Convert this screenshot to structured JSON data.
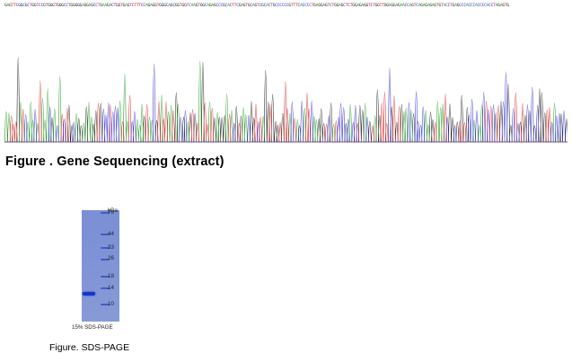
{
  "sequence": {
    "text": "GAGTTCGGCGCTGGTCCGTGGGTGGGCCTGGGGGAGGAGCCTGAAGACTGGTGAGTCTTTCCAGAGGTGGGCAGCGGTGGTCAAGTGGCAGAGCCCGCACTTCGAGTGCAGTCGCACTGCCCCCCGTTTCACCCCTGAGGAGTCTGGAGCTCTGGAGAGGTCTGGTTGGAGGAGAACCAGTCAGAGAGAGTGTACCTGAGCCCACCCACCCCACCTAGAGTG"
  },
  "chromatogram": {
    "colors": {
      "A": "#1f9b1f",
      "C": "#2b2bd6",
      "G": "#1a1a1a",
      "T": "#d62020"
    }
  },
  "gene_figure": {
    "caption": "Figure . Gene Sequencing (extract)"
  },
  "gel": {
    "unit_label": "kDa",
    "markers": [
      {
        "label": "70",
        "kda": 70
      },
      {
        "label": "44",
        "kda": 44
      },
      {
        "label": "33",
        "kda": 33
      },
      {
        "label": "26",
        "kda": 26
      },
      {
        "label": "18",
        "kda": 18
      },
      {
        "label": "14",
        "kda": 14
      },
      {
        "label": "10",
        "kda": 10
      }
    ],
    "gel_caption": "15% SDS-PAGE",
    "colors": {
      "lane": "#7e92d6",
      "band": "#1437c8"
    }
  },
  "sds_figure": {
    "caption": "Figure. SDS-PAGE"
  }
}
